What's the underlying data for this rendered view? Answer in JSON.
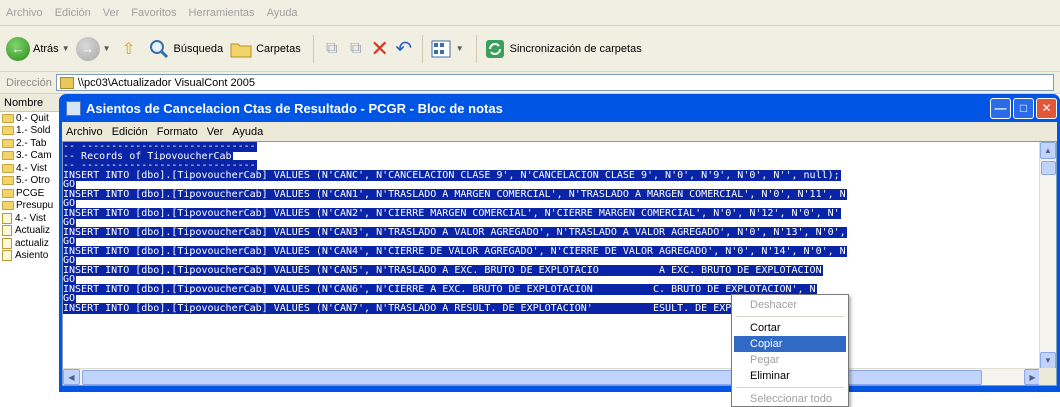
{
  "explorer": {
    "menu": [
      "Archivo",
      "Edición",
      "Ver",
      "Favoritos",
      "Herramientas",
      "Ayuda"
    ],
    "toolbar": {
      "back_label": "Atrás",
      "search_label": "Búsqueda",
      "folders_label": "Carpetas",
      "sync_label": "Sincronización de carpetas"
    },
    "address": {
      "label": "Dirección",
      "value": "\\\\pc03\\Actualizador VisualCont 2005"
    },
    "column_header": "Nombre",
    "files": [
      {
        "name": "0.- Quit",
        "icon": "folder-icon"
      },
      {
        "name": "1.- Sold",
        "icon": "folder-icon"
      },
      {
        "name": "2.- Tab",
        "icon": "folder-icon"
      },
      {
        "name": "3.- Cam",
        "icon": "folder-icon"
      },
      {
        "name": "4.- Vist",
        "icon": "folder-icon"
      },
      {
        "name": "5.- Otro",
        "icon": "folder-icon"
      },
      {
        "name": "PCGE",
        "icon": "folder-icon"
      },
      {
        "name": "Presupu",
        "icon": "folder-icon"
      },
      {
        "name": "4.- Vist",
        "icon": "database-icon"
      },
      {
        "name": "Actualiz",
        "icon": "executable-icon"
      },
      {
        "name": "actualiz",
        "icon": "document-icon"
      },
      {
        "name": "Asiento",
        "icon": "document-icon"
      }
    ]
  },
  "notepad": {
    "title": "Asientos de Cancelacion Ctas de Resultado - PCGR - Bloc de notas",
    "menu": [
      "Archivo",
      "Edición",
      "Formato",
      "Ver",
      "Ayuda"
    ],
    "lines": [
      "-- -----------------------------",
      "-- Records of TipovoucherCab",
      "-- -----------------------------",
      "INSERT INTO [dbo].[TipovoucherCab] VALUES (N'CANC', N'CANCELACION CLASE 9', N'CANCELACION CLASE 9', N'0', N'9', N'0', N'', null);",
      "GO",
      "INSERT INTO [dbo].[TipovoucherCab] VALUES (N'CAN1', N'TRASLADO A MARGEN COMERCIAL', N'TRASLADO A MARGEN COMERCIAL', N'0', N'11', N",
      "GO",
      "INSERT INTO [dbo].[TipovoucherCab] VALUES (N'CAN2', N'CIERRE MARGEN COMERCIAL', N'CIERRE MARGEN COMERCIAL', N'0', N'12', N'0', N'",
      "GO",
      "INSERT INTO [dbo].[TipovoucherCab] VALUES (N'CAN3', N'TRASLADO A VALOR AGREGADO', N'TRASLADO A VALOR AGREGADO', N'0', N'13', N'0',",
      "GO",
      "INSERT INTO [dbo].[TipovoucherCab] VALUES (N'CAN4', N'CIERRE DE VALOR AGREGADO', N'CIERRE DE VALOR AGREGADO', N'0', N'14', N'0', N",
      "GO",
      "INSERT INTO [dbo].[TipovoucherCab] VALUES (N'CAN5', N'TRASLADO A EXC. BRUTO DE EXPLOTACIO          A EXC. BRUTO DE EXPLOTACION",
      "GO",
      "INSERT INTO [dbo].[TipovoucherCab] VALUES (N'CAN6', N'CIERRE A EXC. BRUTO DE EXPLOTACION          C. BRUTO DE EXPLOTACION', N",
      "GO",
      "INSERT INTO [dbo].[TipovoucherCab] VALUES (N'CAN7', N'TRASLADO A RESULT. DE EXPLOTACION'          ESULT. DE EXPLOTACION', N'0"
    ]
  },
  "context_menu": {
    "items": [
      {
        "label": "Deshacer",
        "disabled": true
      },
      {
        "separator": true
      },
      {
        "label": "Cortar",
        "disabled": false
      },
      {
        "label": "Copiar",
        "disabled": false,
        "hover": true
      },
      {
        "label": "Pegar",
        "disabled": true
      },
      {
        "label": "Eliminar",
        "disabled": false
      },
      {
        "separator": true
      },
      {
        "label": "Seleccionar todo",
        "disabled": true
      }
    ]
  },
  "colors": {
    "selection": "#0a24a8",
    "titlebar": "#0055e5",
    "menu_hover": "#316ac5"
  }
}
